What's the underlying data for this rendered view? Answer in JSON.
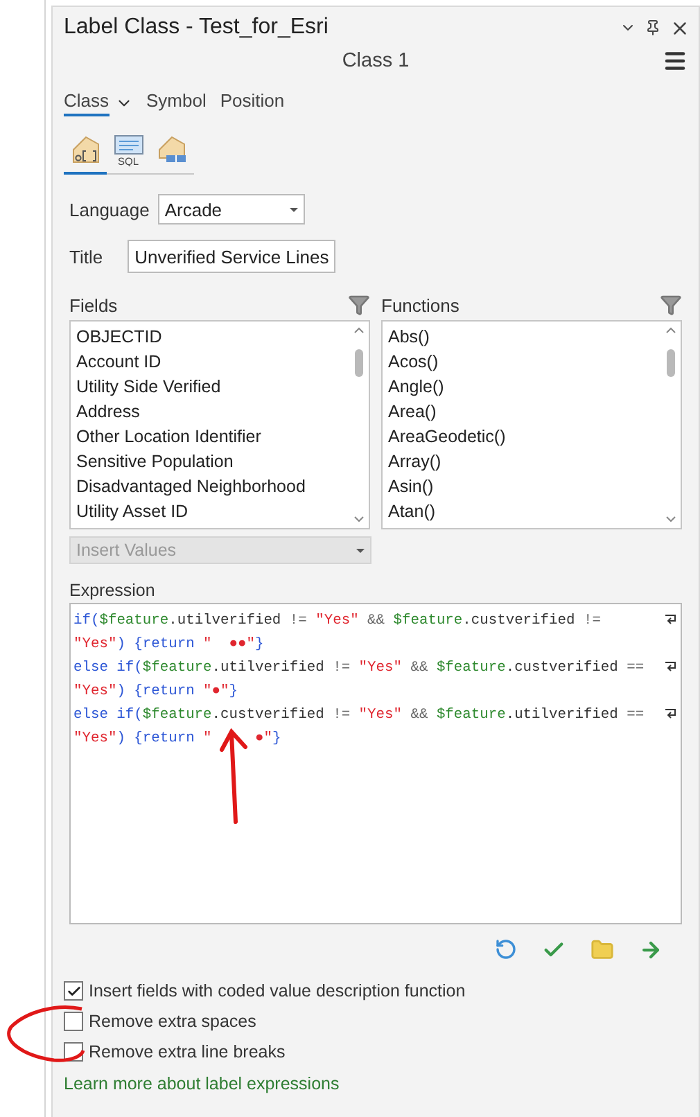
{
  "window": {
    "title": "Label Class - Test_for_Esri"
  },
  "class_name": "Class 1",
  "tabs": [
    {
      "label": "Class",
      "selected": true,
      "dropdown": true
    },
    {
      "label": "Symbol",
      "selected": false,
      "dropdown": false
    },
    {
      "label": "Position",
      "selected": false,
      "dropdown": false
    }
  ],
  "subtabs": [
    {
      "kind": "expression",
      "selected": true
    },
    {
      "kind": "sql",
      "label": "SQL",
      "selected": false
    },
    {
      "kind": "tag",
      "selected": false
    }
  ],
  "language": {
    "label": "Language",
    "value": "Arcade"
  },
  "title_field": {
    "label": "Title",
    "value": "Unverified Service Lines"
  },
  "fields": {
    "label": "Fields",
    "items": [
      "OBJECTID",
      "Account ID",
      "Utility Side Verified",
      "Address",
      "Other Location Identifier",
      "Sensitive Population",
      "Disadvantaged Neighborhood",
      "Utility Asset ID"
    ]
  },
  "functions": {
    "label": "Functions",
    "items": [
      "Abs()",
      "Acos()",
      "Angle()",
      "Area()",
      "AreaGeodetic()",
      "Array()",
      "Asin()",
      "Atan()"
    ]
  },
  "insert_values": {
    "value": "Insert Values",
    "disabled": true
  },
  "expression": {
    "label": "Expression",
    "lines": [
      {
        "wrapped": true,
        "tokens": [
          {
            "kind": "keyword",
            "text": "if("
          },
          {
            "kind": "variable",
            "text": "$feature"
          },
          {
            "kind": "member",
            "text": ".utilverified"
          },
          {
            "kind": "operator",
            "text": " != "
          },
          {
            "kind": "string",
            "text": "\"Yes\""
          },
          {
            "kind": "operator",
            "text": " && "
          },
          {
            "kind": "variable",
            "text": "$feature"
          },
          {
            "kind": "member",
            "text": ".custverified"
          },
          {
            "kind": "operator",
            "text": " !="
          }
        ]
      },
      {
        "wrapped": false,
        "tokens": [
          {
            "kind": "string",
            "text": "\"Yes\""
          },
          {
            "kind": "keyword",
            "text": ") {return "
          },
          {
            "kind": "string",
            "text": "\"  ●●\""
          },
          {
            "kind": "keyword",
            "text": "}"
          }
        ]
      },
      {
        "wrapped": true,
        "tokens": [
          {
            "kind": "keyword",
            "text": "else if("
          },
          {
            "kind": "variable",
            "text": "$feature"
          },
          {
            "kind": "member",
            "text": ".utilverified"
          },
          {
            "kind": "operator",
            "text": " != "
          },
          {
            "kind": "string",
            "text": "\"Yes\""
          },
          {
            "kind": "operator",
            "text": " && "
          },
          {
            "kind": "variable",
            "text": "$feature"
          },
          {
            "kind": "member",
            "text": ".custverified"
          },
          {
            "kind": "operator",
            "text": " =="
          }
        ]
      },
      {
        "wrapped": false,
        "tokens": [
          {
            "kind": "string",
            "text": "\"Yes\""
          },
          {
            "kind": "keyword",
            "text": ") {return "
          },
          {
            "kind": "string",
            "text": "\"●\""
          },
          {
            "kind": "keyword",
            "text": "}"
          }
        ]
      },
      {
        "wrapped": true,
        "tokens": [
          {
            "kind": "keyword",
            "text": "else if("
          },
          {
            "kind": "variable",
            "text": "$feature"
          },
          {
            "kind": "member",
            "text": ".custverified"
          },
          {
            "kind": "operator",
            "text": " != "
          },
          {
            "kind": "string",
            "text": "\"Yes\""
          },
          {
            "kind": "operator",
            "text": " && "
          },
          {
            "kind": "variable",
            "text": "$feature"
          },
          {
            "kind": "member",
            "text": ".utilverified"
          },
          {
            "kind": "operator",
            "text": " =="
          }
        ]
      },
      {
        "wrapped": false,
        "tokens": [
          {
            "kind": "string",
            "text": "\"Yes\""
          },
          {
            "kind": "keyword",
            "text": ") {return "
          },
          {
            "kind": "string",
            "text": "\"     ●\""
          },
          {
            "kind": "keyword",
            "text": "}"
          }
        ]
      }
    ]
  },
  "tools": [
    {
      "kind": "reset"
    },
    {
      "kind": "verify"
    },
    {
      "kind": "open"
    },
    {
      "kind": "apply"
    }
  ],
  "options": [
    {
      "label": "Insert fields with coded value description function",
      "checked": true
    },
    {
      "label": "Remove extra spaces",
      "checked": false
    },
    {
      "label": "Remove extra line breaks",
      "checked": false
    }
  ],
  "link": "Learn more about label expressions"
}
